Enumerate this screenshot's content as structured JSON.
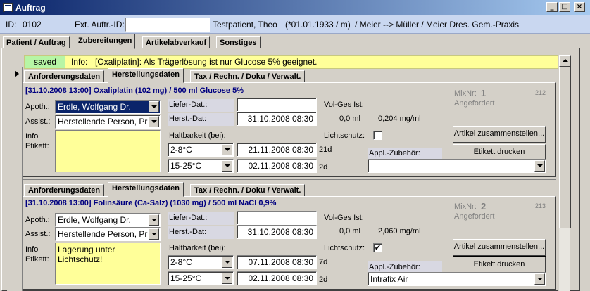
{
  "window": {
    "title": "Auftrag",
    "minimize": "_",
    "maximize": "□",
    "close": "×"
  },
  "header": {
    "id_label": "ID:",
    "id_value": "0102",
    "ext_label": "Ext. Auftr.-ID:",
    "ext_value": "",
    "patient": "Testpatient, Theo",
    "birth": "(*01.01.1933 / m)",
    "doctors": "/  Meier --> Müller / Meier Dres. Gem.-Praxis"
  },
  "tabs": [
    "Patient / Auftrag",
    "Zubereitungen",
    "Artikelabverkauf",
    "Sonstiges"
  ],
  "info_bar": {
    "status": "saved",
    "label": "Info:",
    "text": "[Oxaliplatin]: Als Trägerlösung ist nur Glucose 5% geeignet."
  },
  "labels": {
    "apoth": "Apoth.:",
    "assist": "Assist.:",
    "info": "Info",
    "etikett": "Etikett:",
    "liefer": "Liefer-Dat.:",
    "herst": "Herst.-Dat:",
    "haltbarkeit": "Haltbarkeit (bei):",
    "volges": "Vol-Ges Ist:",
    "lichtschutz": "Lichtschutz:",
    "mixnr": "MixNr:",
    "appl": "Appl.-Zubehör:",
    "btn_assemble": "Artikel zusammenstellen...",
    "btn_print": "Etikett drucken"
  },
  "records": [
    {
      "subtabs": [
        "Anforderungsdaten",
        "Herstellungsdaten",
        "Tax / Rechn. / Doku / Verwalt."
      ],
      "heading": "[31.10.2008 13:00]  Oxaliplatin (102 mg) / 500 ml Glucose 5%",
      "apoth": "Erdle, Wolfgang Dr.",
      "assist": "Herstellende Person, Pr",
      "info_text": "",
      "liefer": "",
      "herst": "31.10.2008  08:30",
      "vol_ml": "0,0 ml",
      "conc": "0,204 mg/ml",
      "mix_no": "1",
      "mix_status": "Angefordert",
      "mix_code": "212",
      "lichtschutz": "",
      "halt1_temp": "2-8°C",
      "halt1_date": "21.11.2008  08:30",
      "halt1_days": "21d",
      "halt2_temp": "15-25°C",
      "halt2_date": "02.11.2008  08:30",
      "halt2_days": "2d",
      "appl_value": ""
    },
    {
      "subtabs": [
        "Anforderungsdaten",
        "Herstellungsdaten",
        "Tax / Rechn. / Doku / Verwalt."
      ],
      "heading": "[31.10.2008 13:00]  Folinsäure (Ca-Salz) (1030 mg) / 500 ml NaCl 0,9%",
      "apoth": "Erdle, Wolfgang Dr.",
      "assist": "Herstellende Person, Pr",
      "info_text": "Lagerung unter Lichtschutz!",
      "liefer": "",
      "herst": "31.10.2008  08:30",
      "vol_ml": "0,0 ml",
      "conc": "2,060 mg/ml",
      "mix_no": "2",
      "mix_status": "Angefordert",
      "mix_code": "213",
      "lichtschutz": "✔",
      "halt1_temp": "2-8°C",
      "halt1_date": "07.11.2008  08:30",
      "halt1_days": "7d",
      "halt2_temp": "15-25°C",
      "halt2_date": "02.11.2008  08:30",
      "halt2_days": "2d",
      "appl_value": "Intrafix Air"
    }
  ]
}
